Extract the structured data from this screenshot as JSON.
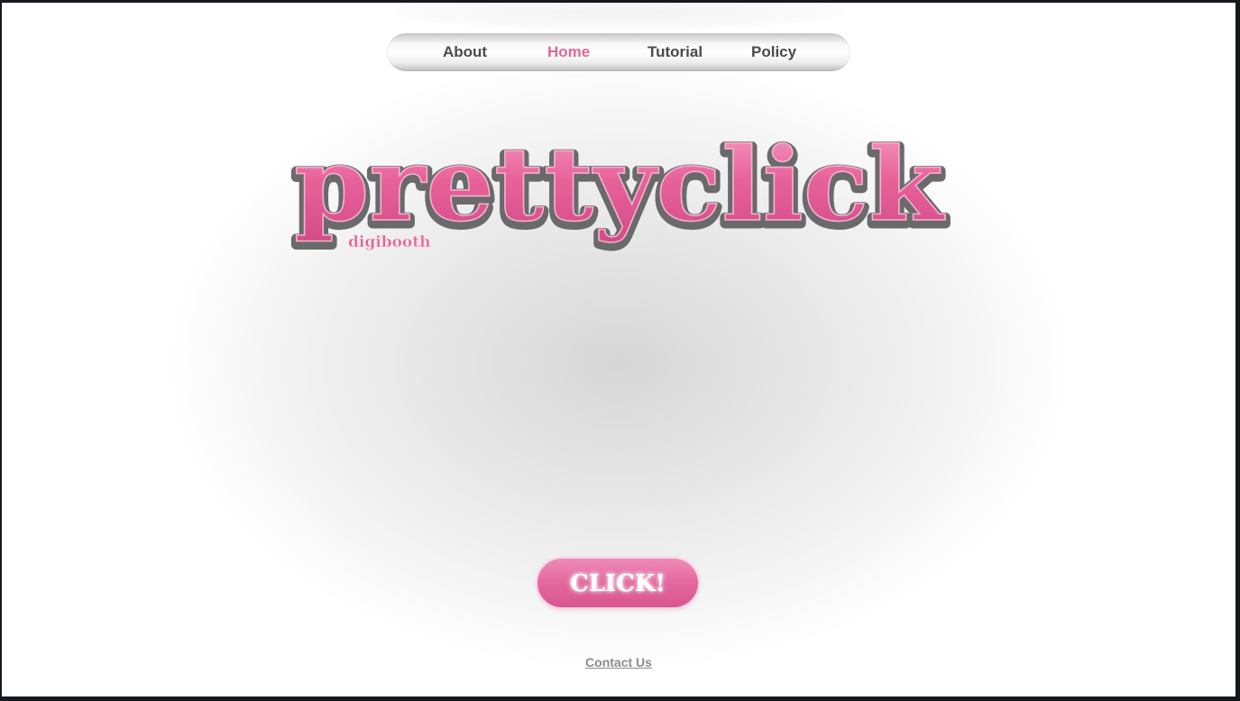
{
  "nav": {
    "items": [
      {
        "label": "About"
      },
      {
        "label": "Home",
        "active": true
      },
      {
        "label": "Tutorial"
      },
      {
        "label": "Policy"
      }
    ]
  },
  "logo": {
    "title": "prettyclick",
    "subtitle": "digibooth"
  },
  "main": {
    "cta_label": "CLICK!"
  },
  "footer": {
    "contact_label": "Contact Us"
  },
  "colors": {
    "accent_pink": "#e0669a",
    "logo_pink": "#e8629a",
    "logo_outline": "#6a6a6a",
    "nav_text": "#4a4a4a",
    "footer_text": "#8c8c8c"
  }
}
